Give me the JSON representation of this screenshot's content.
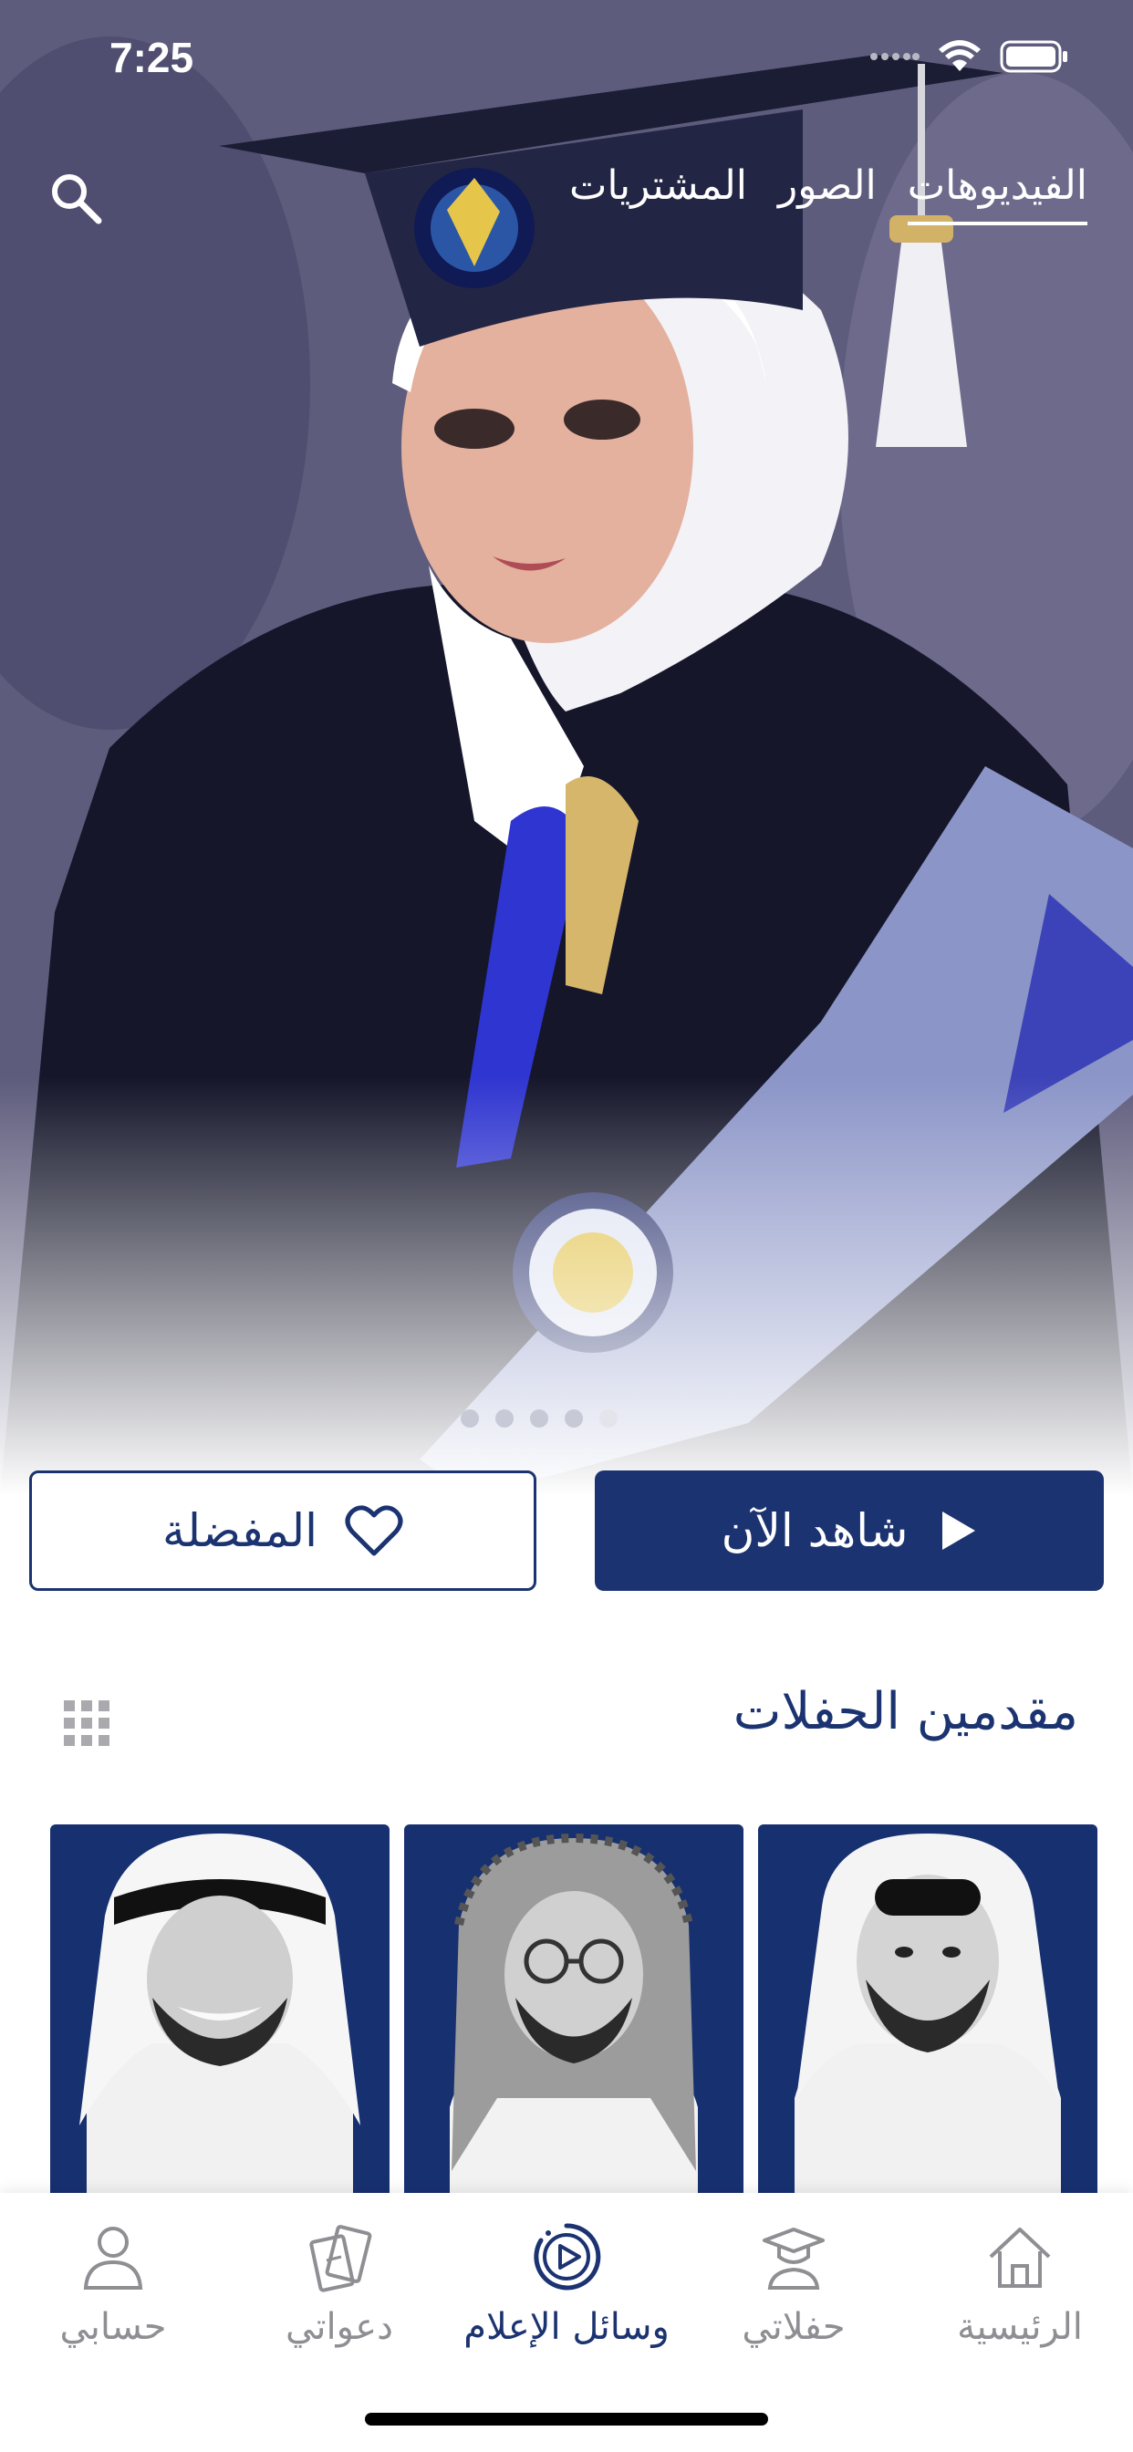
{
  "status": {
    "time": "7:25"
  },
  "top_tabs": [
    {
      "label": "الفيديوهات",
      "active": true
    },
    {
      "label": "الصور",
      "active": false
    },
    {
      "label": "المشتريات",
      "active": false
    }
  ],
  "hero": {
    "pages_total": 5,
    "current_page": 5
  },
  "actions": {
    "watch_label": "شاهد الآن",
    "favorite_label": "المفضلة"
  },
  "section": {
    "title": "مقدمين الحفلات"
  },
  "presenters": [
    {
      "headwear": "white-ghutra"
    },
    {
      "headwear": "checked-shemagh-glasses"
    },
    {
      "headwear": "white-ghutra-black-agal"
    }
  ],
  "tabbar": {
    "items": [
      {
        "label": "الرئيسية",
        "icon": "home-icon",
        "active": false
      },
      {
        "label": "حفلاتي",
        "icon": "graduate-icon",
        "active": false
      },
      {
        "label": "وسائل الإعلام",
        "icon": "media-play-icon",
        "active": true
      },
      {
        "label": "دعواتي",
        "icon": "tickets-icon",
        "active": false
      },
      {
        "label": "حسابي",
        "icon": "person-icon",
        "active": false
      }
    ]
  },
  "colors": {
    "primary": "#1b3370",
    "inactive": "#8e8e93",
    "card_bg": "#173070"
  }
}
